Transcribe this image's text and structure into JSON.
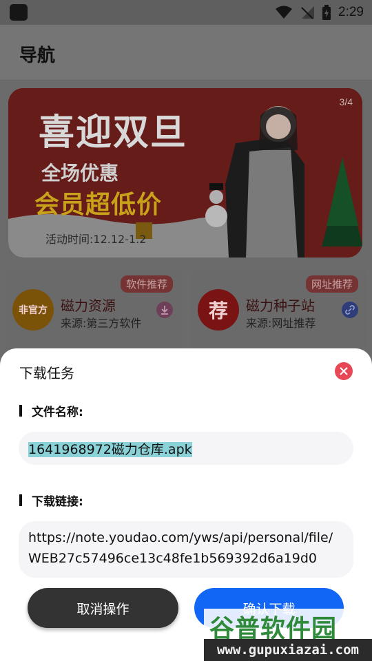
{
  "status_bar": {
    "time": "2:29"
  },
  "header": {
    "title": "导航"
  },
  "banner": {
    "counter": "3/4",
    "headline": "喜迎双旦",
    "line1": "全场优惠",
    "line2": "会员超低价",
    "date": "活动时间:12.12-1.2"
  },
  "cards": [
    {
      "tag": "软件推荐",
      "badge": "非官方",
      "title": "磁力资源",
      "subtitle": "来源:第三方软件",
      "badge_color": "#7a5208",
      "icon": "download-icon"
    },
    {
      "tag": "网址推荐",
      "badge": "荐",
      "title": "磁力种子站",
      "subtitle": "来源:网址推荐",
      "badge_color": "#7a1414",
      "icon": "link-icon"
    }
  ],
  "dialog": {
    "title": "下载任务",
    "file_name_label": "文件名称:",
    "file_name_value": "1641968972磁力仓库.apk",
    "link_label": "下载链接:",
    "link_value": "https://note.youdao.com/yws/api/personal/file/WEB27c57496ce13c48fe1b569392d6a19d0",
    "cancel_label": "取消操作",
    "confirm_label": "确认下载",
    "accent_color": "#1166f5",
    "close_color": "#e84856"
  },
  "watermark": {
    "title": "谷普软件园",
    "url": "www.gupuxiazai.com"
  }
}
